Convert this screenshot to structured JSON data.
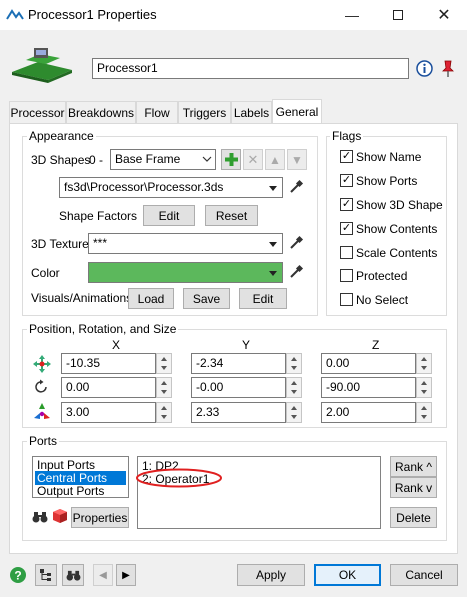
{
  "window": {
    "title": "Processor1  Properties"
  },
  "header": {
    "object_name": "Processor1"
  },
  "tabs": [
    {
      "label": "Processor"
    },
    {
      "label": "Breakdowns"
    },
    {
      "label": "Flow"
    },
    {
      "label": "Triggers"
    },
    {
      "label": "Labels"
    },
    {
      "label": "General"
    }
  ],
  "appearance": {
    "group_label": "Appearance",
    "shapes_label": "3D Shapes",
    "shape_index": "0 -",
    "shape_selected": "Base Frame",
    "shape_file": "fs3d\\Processor\\Processor.3ds",
    "shape_factors_label": "Shape Factors",
    "edit_label": "Edit",
    "reset_label": "Reset",
    "texture_label": "3D Texture",
    "texture_value": "***",
    "color_label": "Color",
    "color_value": "#5cb85c",
    "visuals_label": "Visuals/Animations",
    "load_label": "Load",
    "save_label": "Save",
    "edit2_label": "Edit"
  },
  "flags": {
    "group_label": "Flags",
    "items": [
      {
        "label": "Show Name",
        "checked": "✓"
      },
      {
        "label": "Show Ports",
        "checked": "✓"
      },
      {
        "label": "Show 3D Shape",
        "checked": "✓"
      },
      {
        "label": "Show Contents",
        "checked": "✓"
      },
      {
        "label": "Scale Contents",
        "checked": ""
      },
      {
        "label": "Protected",
        "checked": ""
      },
      {
        "label": "No Select",
        "checked": ""
      }
    ]
  },
  "transform": {
    "group_label": "Position, Rotation, and Size",
    "col_x": "X",
    "col_y": "Y",
    "col_z": "Z",
    "position": {
      "x": "-10.35",
      "y": "-2.34",
      "z": "0.00"
    },
    "rotation": {
      "x": "0.00",
      "y": "-0.00",
      "z": "-90.00"
    },
    "size": {
      "x": "3.00",
      "y": "2.33",
      "z": "2.00"
    }
  },
  "ports": {
    "group_label": "Ports",
    "types": [
      "Input Ports",
      "Central Ports",
      "Output Ports"
    ],
    "selected_type": "Central Ports",
    "connections": [
      "1:  DP2",
      "2:  Operator1"
    ],
    "properties_label": "Properties",
    "rank_up_label": "Rank ^",
    "rank_down_label": "Rank v",
    "delete_label": "Delete"
  },
  "footer": {
    "apply_label": "Apply",
    "ok_label": "OK",
    "cancel_label": "Cancel"
  },
  "colors": {
    "accent": "#0078d7",
    "annotation": "#e02020"
  }
}
